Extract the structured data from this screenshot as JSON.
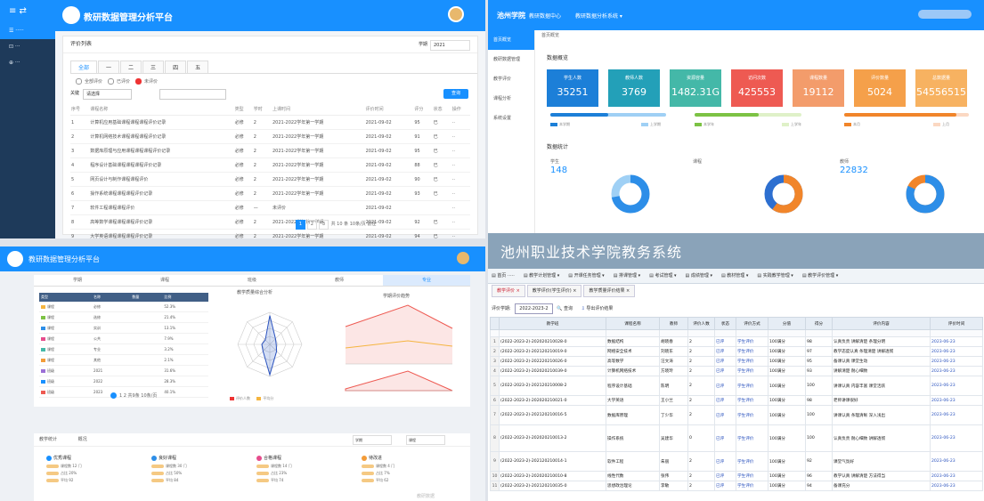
{
  "p1": {
    "sidebar_items": [
      "≡ ⇄",
      "☰ ·····",
      "⊡ ···",
      "⊕ ···"
    ],
    "title": "教研数据管理分析平台",
    "breadcrumb": "评价列表",
    "select_label": "学期",
    "select_value": "2021",
    "tabs": [
      "全部",
      "一",
      "二",
      "三",
      "四",
      "五"
    ],
    "radios": [
      "全部评价",
      "已评价",
      "未评价"
    ],
    "filter_label": "关键",
    "filter_placeholder": "请选择",
    "search_button": "查询",
    "columns": [
      "序号",
      "课程名称",
      "类型",
      "学时",
      "上课时间",
      "评价时间",
      "评分",
      "状态",
      "操作"
    ],
    "rows": [
      [
        "1",
        "计算机应用基础课程课程课程评价记录",
        "必修",
        "2",
        "2021-2022学年第一学期",
        "2021-09-02",
        "95",
        "已",
        "··"
      ],
      [
        "2",
        "计算机网络技术课程课程课程评价记录",
        "必修",
        "2",
        "2021-2022学年第一学期",
        "2021-09-02",
        "91",
        "已",
        "··"
      ],
      [
        "3",
        "数据库原理与应用课程课程课程评价记录",
        "必修",
        "2",
        "2021-2022学年第一学期",
        "2021-09-02",
        "95",
        "已",
        "··"
      ],
      [
        "4",
        "程序设计基础课程课程课程评价记录",
        "必修",
        "2",
        "2021-2022学年第一学期",
        "2021-09-02",
        "88",
        "已",
        "··"
      ],
      [
        "5",
        "网页设计与制作课程课程评价",
        "必修",
        "2",
        "2021-2022学年第一学期",
        "2021-09-02",
        "90",
        "已",
        "··"
      ],
      [
        "6",
        "操作系统课程课程课程评价记录",
        "必修",
        "2",
        "2021-2022学年第一学期",
        "2021-09-02",
        "93",
        "已",
        "··"
      ],
      [
        "7",
        "软件工程课程课程评价",
        "必修",
        "—",
        "未评价",
        "2021-09-02",
        "",
        "",
        "··"
      ],
      [
        "8",
        "高等数学课程课程课程评价记录",
        "必修",
        "2",
        "2021-2022学年第一学期",
        "2021-09-02",
        "92",
        "已",
        "··"
      ],
      [
        "9",
        "大学英语课程课程课程评价记录",
        "必修",
        "2",
        "2021-2022学年第一学期",
        "2021-09-02",
        "94",
        "已",
        "··"
      ],
      [
        "10",
        "思想政治课程课程课程评价记录",
        "必修",
        "2",
        "2021-2022学年第一学期",
        "2021-09-02",
        "89",
        "已",
        "··"
      ]
    ],
    "pager": [
      "1",
      "2",
      "3"
    ],
    "pager_text": "共 10 条  10条/页  前往"
  },
  "p2": {
    "brand": "池州学院",
    "system": "教研数据中心",
    "module": "教研数据分析系统 ▾",
    "sidebar_items": [
      "首页概览",
      "教研数据管理",
      "教学评价",
      "课程分析",
      "系统设置"
    ],
    "breadcrumb": "首页概览",
    "section1": "数据概览",
    "stats": [
      {
        "label": "学生人数",
        "value": "35251",
        "color": "#1c7fd8"
      },
      {
        "label": "教师人数",
        "value": "3769",
        "color": "#23a0b8"
      },
      {
        "label": "资源容量",
        "value": "1482.31G",
        "color": "#44b8a8"
      },
      {
        "label": "访问次数",
        "value": "425553",
        "color": "#ee5a52"
      },
      {
        "label": "课程数量",
        "value": "19112",
        "color": "#f39c6b"
      },
      {
        "label": "评价数量",
        "value": "5024",
        "color": "#f5a04a"
      },
      {
        "label": "总数据量",
        "value": "54556515",
        "color": "#f7b261"
      }
    ],
    "legends": [
      "本学期",
      "上学期",
      "本学年",
      "上学年",
      "本月",
      "上月"
    ],
    "section2": "数据统计",
    "donuts": [
      {
        "title": "学生",
        "value": "148",
        "pct": 0.72,
        "color": "#2d8ee8",
        "bg": "#9fd0f5"
      },
      {
        "title": "课程",
        "value": "",
        "pct": 0.6,
        "color": "#f1852a",
        "bg": "#2d6fd0"
      },
      {
        "title": "教师",
        "value": "22832",
        "pct": 0.82,
        "color": "#2d8ee8",
        "bg": "#f1852a"
      }
    ]
  },
  "p3": {
    "title": "教研数据管理分析平台",
    "tabs": [
      "学期",
      "课程",
      "班级",
      "教师",
      "专业"
    ],
    "table_head": [
      "类型",
      "名称",
      "数量",
      "比例"
    ],
    "table_rows": [
      [
        "课程",
        "必修",
        "52.3%"
      ],
      [
        "课程",
        "选修",
        "21.4%"
      ],
      [
        "课程",
        "实训",
        "13.1%"
      ],
      [
        "课程",
        "公共",
        "7.9%"
      ],
      [
        "课程",
        "专业",
        "3.2%"
      ],
      [
        "课程",
        "其他",
        "2.1%"
      ],
      [
        "班级",
        "2021",
        "31.6%"
      ],
      [
        "班级",
        "2022",
        "28.3%"
      ],
      [
        "班级",
        "2023",
        "40.1%"
      ]
    ],
    "pager": "1  2  共9条  10条/页",
    "radar_title": "教学质量综合分析",
    "area_title": "学期评价趋势",
    "legend": [
      "评价人数",
      "平均分"
    ],
    "bottom_title": "教学统计",
    "bottom_tab": "概况",
    "bottom_filter1": "学期",
    "bottom_filter2": "课程",
    "cards": [
      {
        "title": "优秀课程",
        "color": "#1890ff",
        "rows": [
          "课程数 12 门",
          "占比 20%",
          "平均 92"
        ]
      },
      {
        "title": "良好课程",
        "color": "#2d8ee8",
        "rows": [
          "课程数 30 门",
          "占比 50%",
          "平均 84"
        ]
      },
      {
        "title": "合格课程",
        "color": "#e64c8c",
        "rows": [
          "课程数 14 门",
          "占比 23%",
          "平均 74"
        ]
      },
      {
        "title": "待改进",
        "color": "#f39c38",
        "rows": [
          "课程数 4 门",
          "占比 7%",
          "平均 62"
        ]
      }
    ],
    "watermark": "教研数据"
  },
  "p4": {
    "header": "池州职业技术学院教务系统",
    "menu": [
      "首页 ·····",
      "教学计划管理 ▾",
      "开课任务管理 ▾",
      "排课管理 ▾",
      "考试管理 ▾",
      "成绩管理 ▾",
      "教材管理 ▾",
      "实践教学管理 ▾",
      "教学评价管理 ▾"
    ],
    "tabs": [
      "教学评价 ×",
      "教学评价(学生评价) ×",
      "教学质量评价结果 ×"
    ],
    "term_label": "评价学期:",
    "term_value": "2022-2023-2",
    "tool_find": "查询",
    "tool_export": "导出评价结果",
    "columns": [
      "教学班",
      "课程名称",
      "教师",
      "评价人数",
      "状态",
      "评价方式",
      "分值",
      "得分",
      "评价内容",
      "评价时间"
    ],
    "rows": [
      [
        "1",
        "(2022-2023-2)-202020210028-0",
        "数据结构",
        "胡晓春",
        "2",
        "已评",
        "学生评价",
        "100满分",
        "98",
        "认真负责 讲解清楚 条理分明",
        "2023-06-23"
      ],
      [
        "2",
        "(2022-2023-2)-202120210019-0",
        "网络安全技术",
        "刘晓东",
        "2",
        "已评",
        "学生评价",
        "100满分",
        "97",
        "教学态度认真 条理清楚 讲解透彻",
        "2023-06-23"
      ],
      [
        "3",
        "(2022-2023-2)-202220210026-0",
        "高等数学",
        "汪文涛",
        "2",
        "已评",
        "学生评价",
        "100满分",
        "95",
        "备课认真 课堂生动",
        "2023-06-23"
      ],
      [
        "4",
        "(2022-2023-2)-202020210039-0",
        "计算机网络技术",
        "方晓玲",
        "2",
        "已评",
        "学生评价",
        "100满分",
        "93",
        "讲解清楚 耐心细致",
        "2023-06-23"
      ],
      [
        "5",
        "(2022-2023-2)-202120210008-2",
        "程序设计基础",
        "陈明",
        "2",
        "已评",
        "学生评价",
        "100满分",
        "100",
        "讲课认真 内容丰富 课堂活跃",
        "2023-06-23"
      ],
      [
        "6",
        "(2022-2023-2)-202020210021-0",
        "大学英语",
        "王小兰",
        "2",
        "已评",
        "学生评价",
        "100满分",
        "98",
        "老师讲课很好",
        "2023-06-23"
      ],
      [
        "7",
        "(2022-2023-2)-202120210016-5",
        "数据库原理",
        "丁少华",
        "2",
        "已评",
        "学生评价",
        "100满分",
        "100",
        "讲课认真 条理清晰 深入浅出",
        "2023-06-23"
      ],
      [
        "8",
        "(2022-2023-2)-202020210013-2",
        "操作系统",
        "吴建华",
        "0",
        "已评",
        "学生评价",
        "100满分",
        "100",
        "认真负责 耐心细致 讲解透彻",
        "2023-06-23"
      ],
      [
        "9",
        "(2022-2023-2)-202120210014-1",
        "软件工程",
        "朱丽",
        "2",
        "已评",
        "学生评价",
        "100满分",
        "92",
        "课堂气氛好",
        "2023-06-23"
      ],
      [
        "10",
        "(2022-2023-2)-202020210010-8",
        "线性代数",
        "张伟",
        "2",
        "已评",
        "学生评价",
        "100满分",
        "96",
        "教学认真 讲解清楚 方法得当",
        "2023-06-23"
      ],
      [
        "11",
        "(2022-2023-2)-202120210035-0",
        "思想政治理论",
        "李敏",
        "2",
        "已评",
        "学生评价",
        "100满分",
        "94",
        "备课充分",
        "2023-06-23"
      ]
    ]
  }
}
